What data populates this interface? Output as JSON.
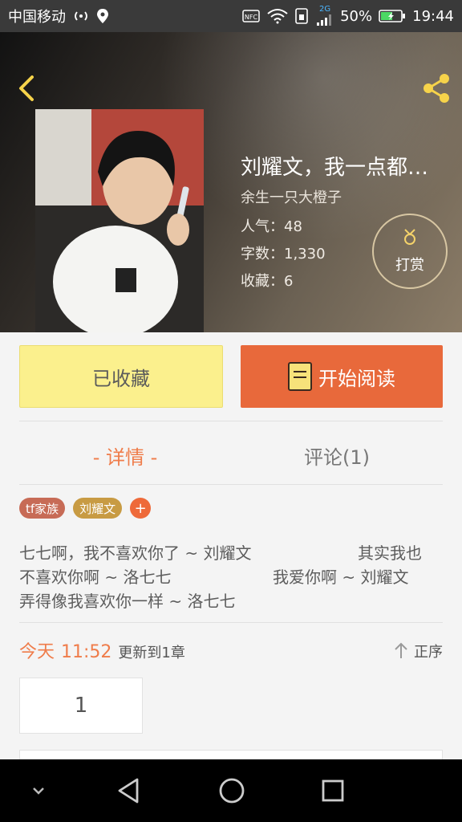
{
  "status_bar": {
    "carrier": "中国移动",
    "battery": "50%",
    "time": "19:44",
    "signal_type": "2G",
    "icons": [
      "hotspot-icon",
      "location-icon",
      "nfc-icon",
      "wifi-icon",
      "sim-icon",
      "signal-icon",
      "battery-icon"
    ]
  },
  "book": {
    "title": "刘耀文，我一点都…",
    "author": "余生一只大橙子",
    "popularity": "人气：48",
    "word_count": "字数：1,330",
    "favorites": "收藏：6",
    "reward_label": "打赏"
  },
  "actions": {
    "favorited_label": "已收藏",
    "read_label": "开始阅读"
  },
  "tabs": [
    {
      "label": "- 详情 -",
      "active": true
    },
    {
      "label": "评论(1)",
      "active": false
    }
  ],
  "tags": [
    "tf家族",
    "刘耀文"
  ],
  "tag_add": "+",
  "description": {
    "line1_a": "七七啊，我不喜欢你了 ~ 刘耀文",
    "line1_b": "其实我也",
    "line2_a": "不喜欢你啊 ~ 洛七七",
    "line2_b": "我爱你啊 ~ 刘耀文",
    "line3": "弄得像我喜欢你一样 ~ 洛七七"
  },
  "update": {
    "today": "今天",
    "time": "11:52",
    "info": "更新到1章"
  },
  "order_label": "正序",
  "chapter_number": "1",
  "colors": {
    "accent": "#e8693b",
    "favorited_bg": "#fbf08d",
    "tag1": "#c76b56",
    "tag2": "#c89b43"
  }
}
